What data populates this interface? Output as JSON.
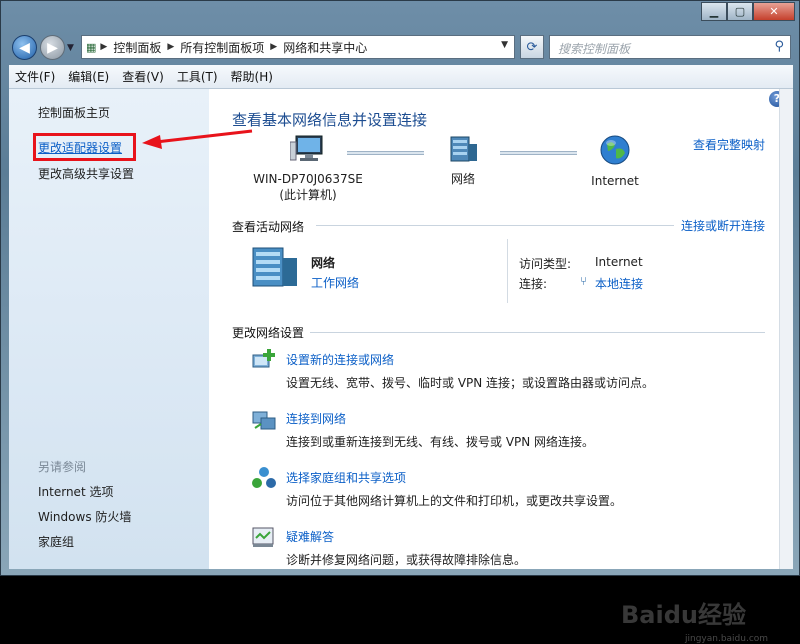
{
  "address_bar": {
    "crumbs": [
      "控制面板",
      "所有控制面板项",
      "网络和共享中心"
    ]
  },
  "search": {
    "placeholder": "搜索控制面板"
  },
  "menu": [
    "文件(F)",
    "编辑(E)",
    "查看(V)",
    "工具(T)",
    "帮助(H)"
  ],
  "sidebar": {
    "links": [
      "控制面板主页",
      "更改适配器设置",
      "更改高级共享设置"
    ],
    "see_also_heading": "另请参阅",
    "see_also": [
      "Internet 选项",
      "Windows 防火墙",
      "家庭组"
    ]
  },
  "main": {
    "title": "查看基本网络信息并设置连接",
    "map_link": "查看完整映射",
    "nodes": {
      "computer_name": "WIN-DP70J0637SE",
      "computer_sub": "(此计算机)",
      "network": "网络",
      "internet": "Internet"
    },
    "active_header": "查看活动网络",
    "active_link": "连接或断开连接",
    "network_name": "网络",
    "network_type": "工作网络",
    "access_label": "访问类型:",
    "access_value": "Internet",
    "connection_label": "连接:",
    "connection_value": "本地连接",
    "change_header": "更改网络设置",
    "tasks": [
      {
        "title": "设置新的连接或网络",
        "desc": "设置无线、宽带、拨号、临时或 VPN 连接；或设置路由器或访问点。"
      },
      {
        "title": "连接到网络",
        "desc": "连接到或重新连接到无线、有线、拨号或 VPN 网络连接。"
      },
      {
        "title": "选择家庭组和共享选项",
        "desc": "访问位于其他网络计算机上的文件和打印机，或更改共享设置。"
      },
      {
        "title": "疑难解答",
        "desc": "诊断并修复网络问题，或获得故障排除信息。"
      }
    ]
  },
  "watermark": {
    "brand": "Baidu经验",
    "sub": "jingyan.baidu.com"
  }
}
